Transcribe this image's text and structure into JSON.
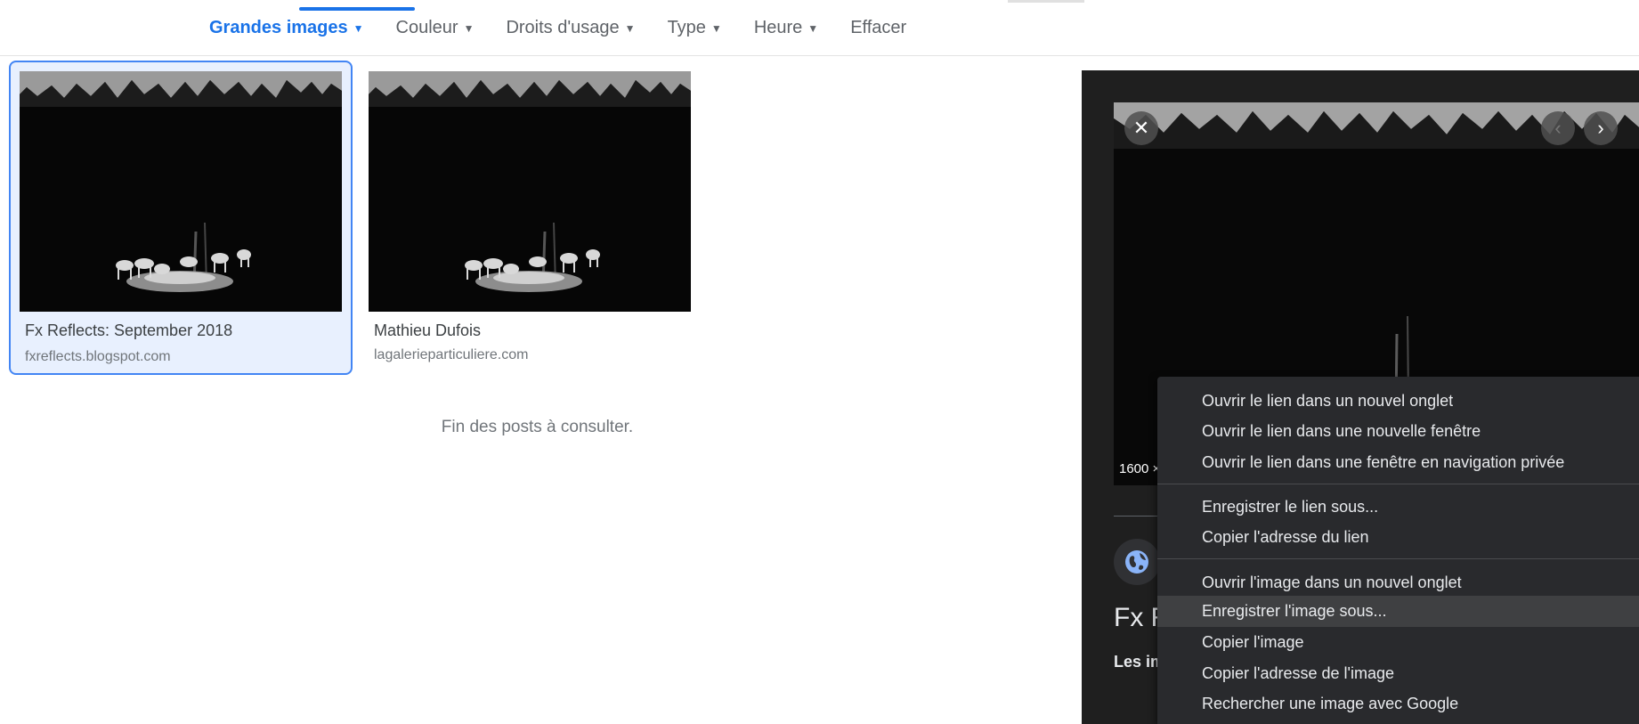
{
  "filters": [
    {
      "label": "Grandes images",
      "active": true,
      "caret": true
    },
    {
      "label": "Couleur",
      "active": false,
      "caret": true
    },
    {
      "label": "Droits d'usage",
      "active": false,
      "caret": true
    },
    {
      "label": "Type",
      "active": false,
      "caret": true
    },
    {
      "label": "Heure",
      "active": false,
      "caret": true
    },
    {
      "label": "Effacer",
      "active": false,
      "caret": false
    }
  ],
  "results": [
    {
      "title": "Fx Reflects: September 2018",
      "source": "fxreflects.blogspot.com",
      "selected": true
    },
    {
      "title": "Mathieu Dufois",
      "source": "lagalerieparticuliere.com",
      "selected": false
    }
  ],
  "end_note": "Fin des posts à consulter.",
  "panel": {
    "close_icon": "close-icon",
    "prev_icon": "chevron-left-icon",
    "next_icon": "chevron-right-icon",
    "dimensions_text": "1600 ×",
    "site_icon": "globe-icon",
    "title_partial": "Fx R",
    "subtitle_partial": "Les im"
  },
  "context_menu": {
    "groups": [
      [
        "Ouvrir le lien dans un nouvel onglet",
        "Ouvrir le lien dans une nouvelle fenêtre",
        "Ouvrir le lien dans une fenêtre en navigation privée"
      ],
      [
        "Enregistrer le lien sous...",
        "Copier l'adresse du lien"
      ],
      [
        "Ouvrir l'image dans un nouvel onglet",
        "Enregistrer l'image sous...",
        "Copier l'image",
        "Copier l'adresse de l'image",
        "Rechercher une image avec Google"
      ]
    ],
    "hovered_item": "Enregistrer l'image sous..."
  },
  "colors": {
    "accent": "#1a73e8",
    "menu_background": "#292a2d",
    "menu_hover": "#3f4042",
    "panel_background": "#1f1f1f"
  }
}
